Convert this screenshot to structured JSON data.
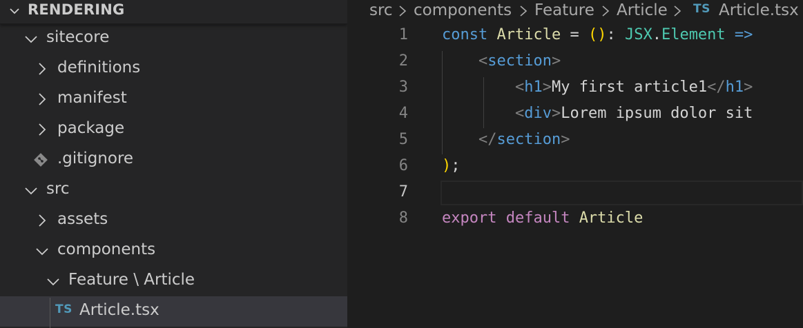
{
  "sidebar": {
    "section_title": "RENDERING",
    "tree": [
      {
        "label": "sitecore",
        "kind": "folder-open"
      },
      {
        "label": "definitions",
        "kind": "folder-closed"
      },
      {
        "label": "manifest",
        "kind": "folder-closed"
      },
      {
        "label": "package",
        "kind": "folder-closed"
      },
      {
        "label": ".gitignore",
        "kind": "git-file"
      },
      {
        "label": "src",
        "kind": "folder-open"
      },
      {
        "label": "assets",
        "kind": "folder-closed"
      },
      {
        "label": "components",
        "kind": "folder-open"
      },
      {
        "label": "Feature \\ Article",
        "kind": "folder-open"
      },
      {
        "label": "Article.tsx",
        "kind": "ts-file",
        "badge": "TS",
        "selected": true
      }
    ]
  },
  "breadcrumb": {
    "parts": [
      "src",
      "components",
      "Feature",
      "Article"
    ],
    "file_badge": "TS",
    "file": "Article.tsx"
  },
  "editor": {
    "line_numbers": [
      "1",
      "2",
      "3",
      "4",
      "5",
      "6",
      "7",
      "8"
    ],
    "active_line": 7,
    "lines": [
      [
        {
          "t": "const ",
          "c": "kw"
        },
        {
          "t": "Article",
          "c": "fn"
        },
        {
          "t": " = ",
          "c": "tx"
        },
        {
          "t": "()",
          "c": "pn"
        },
        {
          "t": ": ",
          "c": "tx"
        },
        {
          "t": "JSX",
          "c": "ty"
        },
        {
          "t": ".",
          "c": "tx"
        },
        {
          "t": "Element",
          "c": "ty"
        },
        {
          "t": " =>",
          "c": "kw"
        }
      ],
      [
        {
          "t": "    ",
          "c": "tx"
        },
        {
          "t": "<",
          "c": "br"
        },
        {
          "t": "section",
          "c": "tg"
        },
        {
          "t": ">",
          "c": "br"
        }
      ],
      [
        {
          "t": "        ",
          "c": "tx"
        },
        {
          "t": "<",
          "c": "br"
        },
        {
          "t": "h1",
          "c": "tg"
        },
        {
          "t": ">",
          "c": "br"
        },
        {
          "t": "My first article1",
          "c": "tx"
        },
        {
          "t": "</",
          "c": "br"
        },
        {
          "t": "h1",
          "c": "tg"
        },
        {
          "t": ">",
          "c": "br"
        }
      ],
      [
        {
          "t": "        ",
          "c": "tx"
        },
        {
          "t": "<",
          "c": "br"
        },
        {
          "t": "div",
          "c": "tg"
        },
        {
          "t": ">",
          "c": "br"
        },
        {
          "t": "Lorem ipsum dolor sit",
          "c": "tx"
        }
      ],
      [
        {
          "t": "    ",
          "c": "tx"
        },
        {
          "t": "</",
          "c": "br"
        },
        {
          "t": "section",
          "c": "tg"
        },
        {
          "t": ">",
          "c": "br"
        }
      ],
      [
        {
          "t": ")",
          "c": "pn"
        },
        {
          "t": ";",
          "c": "tx"
        }
      ],
      [],
      [
        {
          "t": "export ",
          "c": "kw2"
        },
        {
          "t": "default ",
          "c": "kw2"
        },
        {
          "t": "Article",
          "c": "fn"
        }
      ]
    ]
  },
  "colors": {
    "sidebar_bg": "#252526",
    "editor_bg": "#1e1e1e",
    "selection_bg": "#37373d",
    "ts_badge": "#519aba"
  }
}
